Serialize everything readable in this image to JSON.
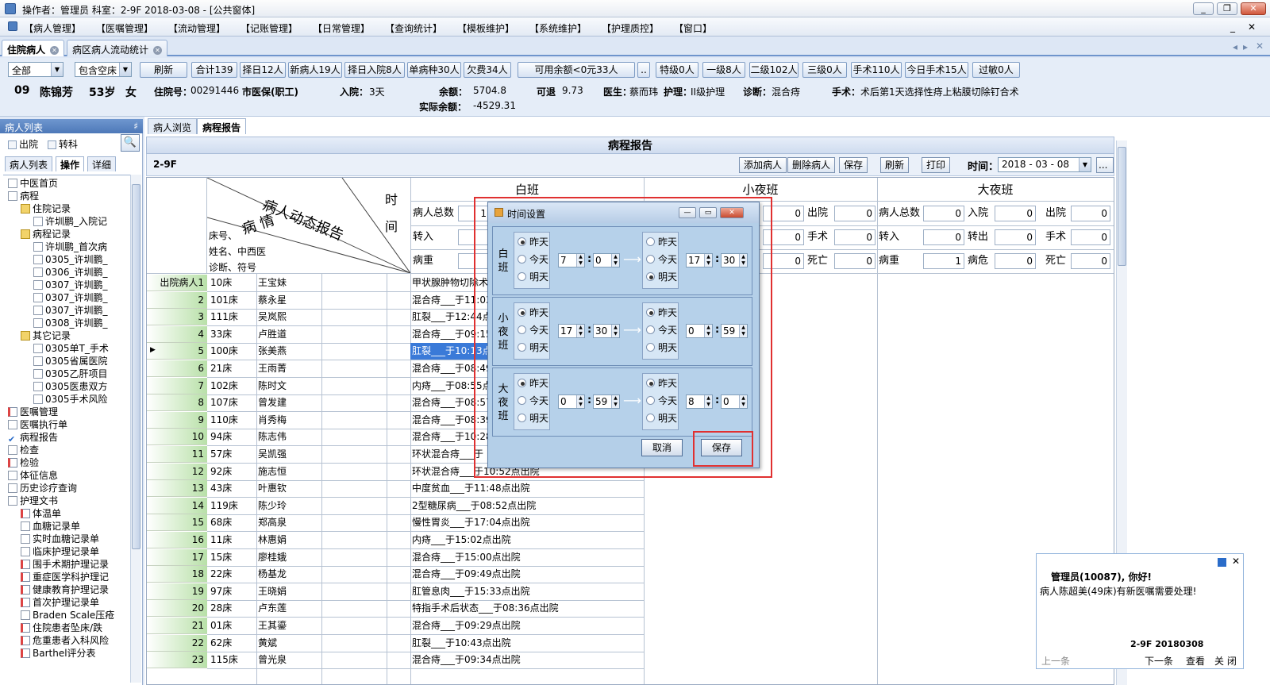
{
  "window": {
    "title": "操作者：管理员  科室：2-9F  2018-03-08 - [公共窗体]",
    "min": "_",
    "max": "❐",
    "close": "✕"
  },
  "menu": [
    "【病人管理】",
    "【医嘱管理】",
    "【流动管理】",
    "【记账管理】",
    "【日常管理】",
    "【查询统计】",
    "【模板维护】",
    "【系统维护】",
    "【护理质控】",
    "【窗口】"
  ],
  "menu_right": [
    "_",
    "✕"
  ],
  "doc_tabs": [
    "住院病人",
    "病区病人流动统计"
  ],
  "filter": {
    "combo1": "全部",
    "combo2": "包含空床",
    "buttons": [
      "刷新",
      "合计139",
      "择日12人",
      "新病人19人",
      "择日入院8人",
      "单病种30人",
      "欠费34人",
      "可用余额<0元33人",
      "..",
      "特级0人",
      "一级8人",
      "二级102人",
      "三级0人",
      "手术110人",
      "今日手术15人",
      "过敏0人"
    ]
  },
  "patient": {
    "bed": "09",
    "name": "陈锦芳",
    "age": "53岁",
    "sex": "女",
    "inpatient_no_label": "住院号：",
    "inpatient_no": "00291446",
    "insurance": "市医保(职工)",
    "admit_label": "入院：",
    "admit": "3天",
    "balance_label": "余额：",
    "balance": "5704.8",
    "refundable_label": "可退",
    "refundable": "9.73",
    "actual_label": "实际余额：",
    "actual": "-4529.31",
    "doctor_label": "医生：",
    "doctor": "蔡而玮",
    "care_label": "护理：",
    "care": "II级护理",
    "diag_label": "诊断：",
    "diag": "混合痔",
    "surgery_label": "手术：",
    "surgery": "术后第1天选择性痔上粘膜切除钉合术"
  },
  "left": {
    "title": "病人列表",
    "pin": "♯",
    "chk_discharge": "出院",
    "chk_transfer": "转科",
    "search": "🔍",
    "tabs": [
      "病人列表",
      "操作",
      "详细"
    ],
    "tree": [
      {
        "t": "中医首页",
        "l": 1,
        "i": "doc"
      },
      {
        "t": "病程",
        "l": 1,
        "i": "doc"
      },
      {
        "t": "住院记录",
        "l": 2,
        "i": "folder"
      },
      {
        "t": "许圳鹏_入院记",
        "l": 3,
        "i": "doc"
      },
      {
        "t": "病程记录",
        "l": 2,
        "i": "folder"
      },
      {
        "t": "许圳鹏_首次病",
        "l": 3,
        "i": "doc"
      },
      {
        "t": "0305_许圳鹏_",
        "l": 3,
        "i": "doc"
      },
      {
        "t": "0306_许圳鹏_",
        "l": 3,
        "i": "doc"
      },
      {
        "t": "0307_许圳鹏_",
        "l": 3,
        "i": "doc"
      },
      {
        "t": "0307_许圳鹏_",
        "l": 3,
        "i": "doc"
      },
      {
        "t": "0307_许圳鹏_",
        "l": 3,
        "i": "doc"
      },
      {
        "t": "0308_许圳鹏_",
        "l": 3,
        "i": "doc"
      },
      {
        "t": "其它记录",
        "l": 2,
        "i": "folder"
      },
      {
        "t": "0305单T_手术",
        "l": 3,
        "i": "doc"
      },
      {
        "t": "0305省属医院",
        "l": 3,
        "i": "doc"
      },
      {
        "t": "0305乙肝项目",
        "l": 3,
        "i": "doc"
      },
      {
        "t": "0305医患双方",
        "l": 3,
        "i": "doc"
      },
      {
        "t": "0305手术风险",
        "l": 3,
        "i": "doc"
      },
      {
        "t": "医嘱管理",
        "l": 1,
        "i": "red"
      },
      {
        "t": "医嘱执行单",
        "l": 1,
        "i": "doc"
      },
      {
        "t": "病程报告",
        "l": 1,
        "i": "check"
      },
      {
        "t": "检查",
        "l": 1,
        "i": "doc"
      },
      {
        "t": "检验",
        "l": 1,
        "i": "red"
      },
      {
        "t": "体征信息",
        "l": 1,
        "i": "doc"
      },
      {
        "t": "历史诊疗查询",
        "l": 1,
        "i": "doc"
      },
      {
        "t": "护理文书",
        "l": 1,
        "i": "doc"
      },
      {
        "t": "体温单",
        "l": 2,
        "i": "red"
      },
      {
        "t": "血糖记录单",
        "l": 2,
        "i": "doc"
      },
      {
        "t": "实时血糖记录单",
        "l": 2,
        "i": "doc"
      },
      {
        "t": "临床护理记录单",
        "l": 2,
        "i": "doc"
      },
      {
        "t": "围手术期护理记录",
        "l": 2,
        "i": "red"
      },
      {
        "t": "重症医学科护理记",
        "l": 2,
        "i": "red"
      },
      {
        "t": "健康教育护理记录",
        "l": 2,
        "i": "red"
      },
      {
        "t": "首次护理记录单",
        "l": 2,
        "i": "red"
      },
      {
        "t": "Braden Scale压疮",
        "l": 2,
        "i": "doc"
      },
      {
        "t": "住院患者坠床/跌",
        "l": 2,
        "i": "red"
      },
      {
        "t": "危重患者入科风险",
        "l": 2,
        "i": "red"
      },
      {
        "t": "Barthel评分表",
        "l": 2,
        "i": "red"
      }
    ]
  },
  "main": {
    "tabs": [
      "病人浏览",
      "病程报告"
    ],
    "report_title": "病程报告",
    "ward": "2-9F",
    "toolbar": {
      "add": "添加病人",
      "del": "删除病人",
      "save": "保存",
      "refresh": "刷新",
      "print": "打印",
      "time_label": "时间：",
      "time": "2018 - 03 - 08",
      "more": "..."
    },
    "header_diag": {
      "title": "病人动态报告",
      "sub1": "时",
      "sub2": "间",
      "bingqing": "病 情",
      "f1": "床号、",
      "f2": "姓名、中西医",
      "f3": "诊断、符号"
    },
    "shifts": [
      "白班",
      "小夜班",
      "大夜班"
    ],
    "stat_labels": {
      "total": "病人总数",
      "in": "入院",
      "out": "出院",
      "transfer_in": "转入",
      "transfer_out": "转出",
      "surgery": "手术",
      "severe": "病重",
      "critical": "病危",
      "death": "死亡"
    },
    "day": {
      "total": "1"
    },
    "evening": {
      "out": "0",
      "surgery": "0",
      "death": "0",
      "v1": "0",
      "v2": "0",
      "v3": "0"
    },
    "night": {
      "total": "0",
      "in": "0",
      "out": "0",
      "transfer_in": "0",
      "transfer_out": "0",
      "surgery": "0",
      "severe": "1",
      "critical": "0",
      "death": "0"
    },
    "rows": [
      {
        "rh": "出院病人1",
        "bed": "10床",
        "name": "王宝妹",
        "txt": "甲状腺肿物切除术"
      },
      {
        "rh": "2",
        "bed": "101床",
        "name": "蔡永星",
        "txt": "混合痔___于11:03"
      },
      {
        "rh": "3",
        "bed": "111床",
        "name": "吴岚熙",
        "txt": "肛裂___于12:44点"
      },
      {
        "rh": "4",
        "bed": "33床",
        "name": "卢胜道",
        "txt": "混合痔___于09:15"
      },
      {
        "rh": "5",
        "bed": "100床",
        "name": "张美燕",
        "txt": "肛裂___于10:13点",
        "sel": true
      },
      {
        "rh": "6",
        "bed": "21床",
        "name": "王雨菁",
        "txt": "混合痔___于08:49"
      },
      {
        "rh": "7",
        "bed": "102床",
        "name": "陈时文",
        "txt": "内痔___于08:55点"
      },
      {
        "rh": "8",
        "bed": "107床",
        "name": "曾发建",
        "txt": "混合痔___于08:57"
      },
      {
        "rh": "9",
        "bed": "110床",
        "name": "肖秀梅",
        "txt": "混合痔___于08:39"
      },
      {
        "rh": "10",
        "bed": "94床",
        "name": "陈志伟",
        "txt": "混合痔___于10:28"
      },
      {
        "rh": "11",
        "bed": "57床",
        "name": "吴凯强",
        "txt": "环状混合痔___于"
      },
      {
        "rh": "12",
        "bed": "92床",
        "name": "施志恒",
        "txt": "环状混合痔___于10:52点出院"
      },
      {
        "rh": "13",
        "bed": "43床",
        "name": "叶惠钦",
        "txt": "中度贫血___于11:48点出院"
      },
      {
        "rh": "14",
        "bed": "119床",
        "name": "陈少玲",
        "txt": "2型糖尿病___于08:52点出院"
      },
      {
        "rh": "15",
        "bed": "68床",
        "name": "郑高泉",
        "txt": "慢性胃炎___于17:04点出院"
      },
      {
        "rh": "16",
        "bed": "11床",
        "name": "林惠娟",
        "txt": "内痔___于15:02点出院"
      },
      {
        "rh": "17",
        "bed": "15床",
        "name": "廖桂娥",
        "txt": "混合痔___于15:00点出院"
      },
      {
        "rh": "18",
        "bed": "22床",
        "name": "杨基龙",
        "txt": "混合痔___于09:49点出院"
      },
      {
        "rh": "19",
        "bed": "97床",
        "name": "王晓娟",
        "txt": "肛管息肉___于15:33点出院"
      },
      {
        "rh": "20",
        "bed": "28床",
        "name": "卢东莲",
        "txt": "特指手术后状态___于08:36点出院"
      },
      {
        "rh": "21",
        "bed": "01床",
        "name": "王其鎏",
        "txt": "混合痔___于09:29点出院"
      },
      {
        "rh": "22",
        "bed": "62床",
        "name": "黄斌",
        "txt": "肛裂___于10:43点出院"
      },
      {
        "rh": "23",
        "bed": "115床",
        "name": "曾光泉",
        "txt": "混合痔___于09:34点出院"
      }
    ]
  },
  "dialog": {
    "title": "时间设置",
    "min": "—",
    "max": "▭",
    "close": "✕",
    "radio": [
      "昨天",
      "今天",
      "明天"
    ],
    "groups": [
      {
        "label": "白班",
        "from_sel": 0,
        "fh": "7",
        "fm": "0",
        "to_sel": 2,
        "th": "17",
        "tm": "30"
      },
      {
        "label": "小夜班",
        "from_sel": 0,
        "fh": "17",
        "fm": "30",
        "to_sel": 0,
        "th": "0",
        "tm": "59"
      },
      {
        "label": "大夜班",
        "from_sel": 0,
        "fh": "0",
        "fm": "59",
        "to_sel": 0,
        "th": "8",
        "tm": "0"
      }
    ],
    "cancel": "取消",
    "save": "保存",
    "colon": ":",
    "arrow": "⟶"
  },
  "notify": {
    "hello": "管理员(10087), 你好!",
    "msg": "病人陈超美(49床)有新医嘱需要处理!",
    "foot": "2-9F 20180308",
    "prev": "上一条",
    "next": "下一条",
    "view": "查看",
    "close": "关 闭"
  }
}
